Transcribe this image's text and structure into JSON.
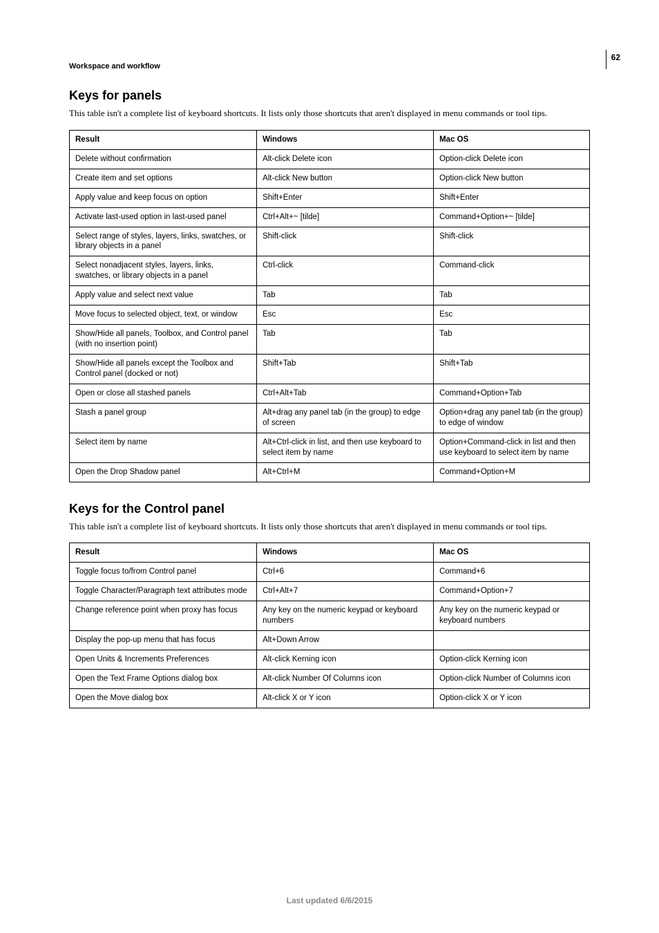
{
  "page_number": "62",
  "breadcrumb": "Workspace and workflow",
  "section1": {
    "title": "Keys for panels",
    "intro": "This table isn't a complete list of keyboard shortcuts. It lists only those shortcuts that aren't displayed in menu commands or tool tips.",
    "headers": {
      "result": "Result",
      "windows": "Windows",
      "mac": "Mac OS"
    },
    "rows": [
      {
        "result": "Delete without confirmation",
        "win": "Alt-click Delete icon",
        "mac": "Option-click Delete icon"
      },
      {
        "result": "Create item and set options",
        "win": "Alt-click New button",
        "mac": "Option-click New button"
      },
      {
        "result": "Apply value and keep focus on option",
        "win": "Shift+Enter",
        "mac": "Shift+Enter"
      },
      {
        "result": "Activate last-used option in last-used panel",
        "win": "Ctrl+Alt+~ [tilde]",
        "mac": "Command+Option+~ [tilde]"
      },
      {
        "result": "Select range of styles, layers, links, swatches, or library objects in a panel",
        "win": "Shift-click",
        "mac": "Shift-click"
      },
      {
        "result": "Select nonadjacent styles, layers, links, swatches, or library objects in a panel",
        "win": "Ctrl-click",
        "mac": "Command-click"
      },
      {
        "result": "Apply value and select next value",
        "win": "Tab",
        "mac": "Tab"
      },
      {
        "result": "Move focus to selected object, text, or window",
        "win": "Esc",
        "mac": "Esc"
      },
      {
        "result": "Show/Hide all panels, Toolbox, and Control panel (with no insertion point)",
        "win": "Tab",
        "mac": "Tab"
      },
      {
        "result": "Show/Hide all panels except the Toolbox and Control panel (docked or not)",
        "win": "Shift+Tab",
        "mac": "Shift+Tab"
      },
      {
        "result": "Open or close all stashed panels",
        "win": "Ctrl+Alt+Tab",
        "mac": "Command+Option+Tab"
      },
      {
        "result": "Stash a panel group",
        "win": "Alt+drag any panel tab (in the group) to edge of screen",
        "mac": "Option+drag any panel tab (in the group) to edge of window"
      },
      {
        "result": "Select item by name",
        "win": "Alt+Ctrl-click in list, and then use keyboard to select item by name",
        "mac": "Option+Command-click in list and then use keyboard to select item by name"
      },
      {
        "result": "Open the Drop Shadow panel",
        "win": "Alt+Ctrl+M",
        "mac": "Command+Option+M"
      }
    ]
  },
  "section2": {
    "title": "Keys for the Control panel",
    "intro": "This table isn't a complete list of keyboard shortcuts. It lists only those shortcuts that aren't displayed in menu commands or tool tips.",
    "headers": {
      "result": "Result",
      "windows": "Windows",
      "mac": "Mac OS"
    },
    "rows": [
      {
        "result": "Toggle focus to/from Control panel",
        "win": "Ctrl+6",
        "mac": "Command+6"
      },
      {
        "result": "Toggle Character/Paragraph text attributes mode",
        "win": "Ctrl+Alt+7",
        "mac": "Command+Option+7"
      },
      {
        "result": "Change reference point when proxy has focus",
        "win": "Any key on the numeric keypad or keyboard numbers",
        "mac": "Any key on the numeric keypad or keyboard numbers"
      },
      {
        "result": "Display the pop-up menu that has focus",
        "win": "Alt+Down Arrow",
        "mac": ""
      },
      {
        "result": "Open Units & Increments Preferences",
        "win": "Alt-click Kerning icon",
        "mac": "Option-click Kerning icon"
      },
      {
        "result": "Open the Text Frame Options dialog box",
        "win": "Alt-click Number Of Columns icon",
        "mac": "Option-click Number of Columns icon"
      },
      {
        "result": "Open the Move dialog box",
        "win": "Alt-click X or Y icon",
        "mac": "Option-click X or Y icon"
      }
    ]
  },
  "footer": "Last updated 6/6/2015"
}
